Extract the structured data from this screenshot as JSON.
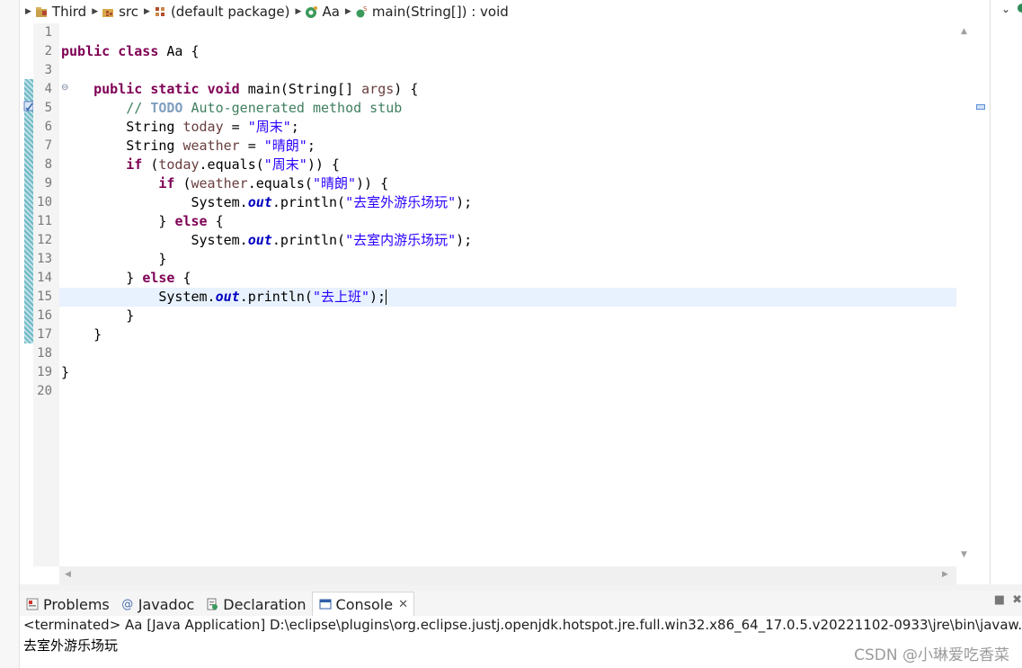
{
  "breadcrumb": {
    "items": [
      {
        "label": "Third",
        "icon": "project-icon"
      },
      {
        "label": "src",
        "icon": "source-folder-icon"
      },
      {
        "label": "(default package)",
        "icon": "package-icon"
      },
      {
        "label": "Aa",
        "icon": "class-icon"
      },
      {
        "label": "main(String[]) : void",
        "icon": "method-icon"
      }
    ]
  },
  "editor": {
    "line_numbers": [
      "1",
      "2",
      "3",
      "4",
      "5",
      "6",
      "7",
      "8",
      "9",
      "10",
      "11",
      "12",
      "13",
      "14",
      "15",
      "16",
      "17",
      "18",
      "19",
      "20"
    ],
    "current_line": 15,
    "code": {
      "l2_kw1": "public",
      "l2_kw2": "class",
      "l2_name": "Aa {",
      "l4_kw1": "public",
      "l4_kw2": "static",
      "l4_kw3": "void",
      "l4_sig": "main(String[] ",
      "l4_arg": "args",
      "l4_end": ") {",
      "l5_comment": "// ",
      "l5_todo": "TODO",
      "l5_rest": " Auto-generated method stub",
      "l6_type": "String ",
      "l6_var": "today",
      "l6_eq": " = ",
      "l6_str": "\"周末\"",
      "l6_end": ";",
      "l7_type": "String ",
      "l7_var": "weather",
      "l7_eq": " = ",
      "l7_str": "\"晴朗\"",
      "l7_end": ";",
      "l8_kw": "if",
      "l8_a": " (",
      "l8_var": "today",
      "l8_b": ".equals(",
      "l8_str": "\"周末\"",
      "l8_c": ")) {",
      "l9_kw": "if",
      "l9_a": " (",
      "l9_var": "weather",
      "l9_b": ".equals(",
      "l9_str": "\"晴朗\"",
      "l9_c": ")) {",
      "l10_a": "System.",
      "l10_fld": "out",
      "l10_b": ".println(",
      "l10_str": "\"去室外游乐场玩\"",
      "l10_c": ");",
      "l11_a": "} ",
      "l11_kw": "else",
      "l11_b": " {",
      "l12_a": "System.",
      "l12_fld": "out",
      "l12_b": ".println(",
      "l12_str": "\"去室内游乐场玩\"",
      "l12_c": ");",
      "l13": "}",
      "l14_a": "} ",
      "l14_kw": "else",
      "l14_b": " {",
      "l15_a": "System.",
      "l15_fld": "out",
      "l15_b": ".println(",
      "l15_str": "\"去上班\"",
      "l15_c": ");",
      "l16": "}",
      "l17": "}",
      "l19": "}"
    }
  },
  "bottom": {
    "tabs": [
      {
        "label": "Problems",
        "icon": "problems-icon"
      },
      {
        "label": "Javadoc",
        "icon": "javadoc-icon"
      },
      {
        "label": "Declaration",
        "icon": "declaration-icon"
      },
      {
        "label": "Console",
        "icon": "console-icon",
        "active": true
      }
    ],
    "console_status": "<terminated> Aa [Java Application] D:\\eclipse\\plugins\\org.eclipse.justj.openjdk.hotspot.jre.full.win32.x86_64_17.0.5.v20221102-0933\\jre\\bin\\javaw.exe  (",
    "console_output": "去室外游乐场玩"
  },
  "watermark": "CSDN @小琳爱吃香菜",
  "colors": {
    "keyword": "#7f0055",
    "string": "#2a00ff",
    "comment": "#3f7f5f",
    "field": "#0000c0",
    "current_line": "#e8f2fe"
  }
}
